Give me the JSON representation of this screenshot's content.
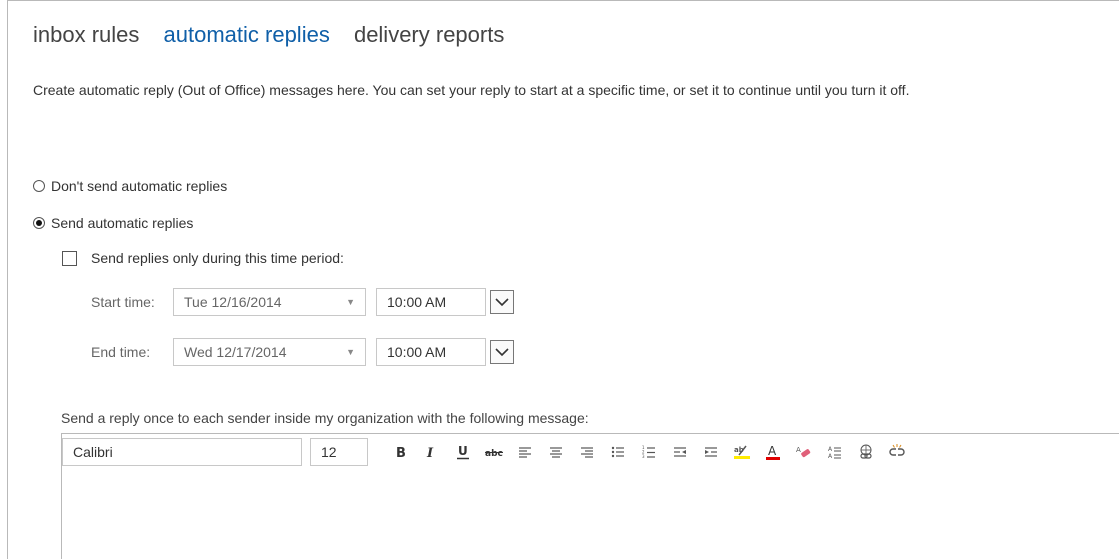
{
  "tabs": [
    {
      "label": "inbox rules",
      "active": false
    },
    {
      "label": "automatic replies",
      "active": true
    },
    {
      "label": "delivery reports",
      "active": false
    }
  ],
  "intro_text": "Create automatic reply (Out of Office) messages here. You can set your reply to start at a specific time, or set it to continue until you turn it off.",
  "options": {
    "dont_send_label": "Don't send automatic replies",
    "send_label": "Send automatic replies",
    "selected": "send"
  },
  "time_period": {
    "checkbox_label": "Send replies only during this time period:",
    "checked": false,
    "start_label": "Start time:",
    "start_date": "Tue 12/16/2014",
    "start_time": "10:00 AM",
    "end_label": "End time:",
    "end_date": "Wed 12/17/2014",
    "end_time": "10:00 AM"
  },
  "reply_inside": {
    "label": "Send a reply once to each sender inside my organization with the following message:",
    "font_name": "Calibri",
    "font_size": "12"
  },
  "toolbar_icons": [
    "bold-icon",
    "italic-icon",
    "underline-icon",
    "strikethrough-icon",
    "align-left-icon",
    "align-center-icon",
    "align-right-icon",
    "bullet-list-icon",
    "numbered-list-icon",
    "decrease-indent-icon",
    "increase-indent-icon",
    "highlight-icon",
    "font-color-icon",
    "clear-formatting-icon",
    "superscript-subscript-icon",
    "insert-link-icon",
    "remove-link-icon"
  ],
  "colors": {
    "active_tab": "#0f5fa8",
    "highlight": "#ffeb00",
    "font_color": "#e00000",
    "eraser": "#e0607a"
  }
}
